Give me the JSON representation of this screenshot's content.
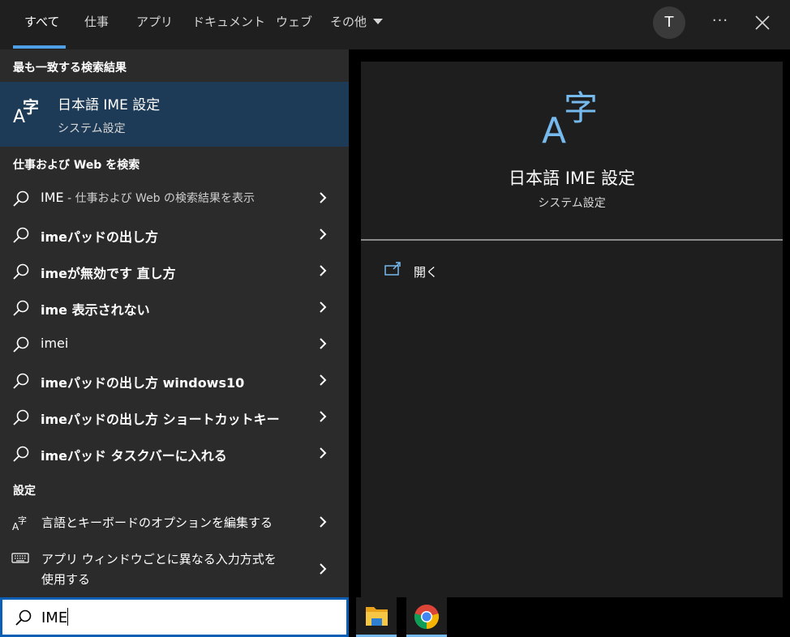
{
  "tabs": [
    {
      "label": "すべて",
      "active": true
    },
    {
      "label": "仕事"
    },
    {
      "label": "アプリ"
    },
    {
      "label": "ドキュメント"
    },
    {
      "label": "ウェブ"
    },
    {
      "label": "その他"
    }
  ],
  "header": {
    "avatar_letter": "T",
    "more_label": "···"
  },
  "best_match": {
    "heading": "最も一致する検索結果",
    "title": "日本語 IME 設定",
    "subtitle": "システム設定"
  },
  "web_section": {
    "heading": "仕事および Web を検索",
    "first": {
      "term": "IME",
      "hint": " - 仕事および Web の検索結果を表示"
    },
    "suggestions": [
      "imeパッドの出し方",
      "imeが無効です 直し方",
      "ime 表示されない",
      "imei",
      "imeパッドの出し方 windows10",
      "imeパッドの出し方 ショートカットキー",
      "imeパッド タスクバーに入れる"
    ]
  },
  "settings_section": {
    "heading": "設定",
    "items": [
      "言語とキーボードのオプションを編集する",
      "アプリ ウィンドウごとに異なる入力方式を",
      "使用する"
    ]
  },
  "preview": {
    "title": "日本語 IME 設定",
    "subtitle": "システム設定",
    "open_label": "開く"
  },
  "search": {
    "value": "IME"
  },
  "colors": {
    "accent": "#4f9fe7",
    "selected_bg": "#1d3a56",
    "icon_blue": "#76b9ed"
  }
}
